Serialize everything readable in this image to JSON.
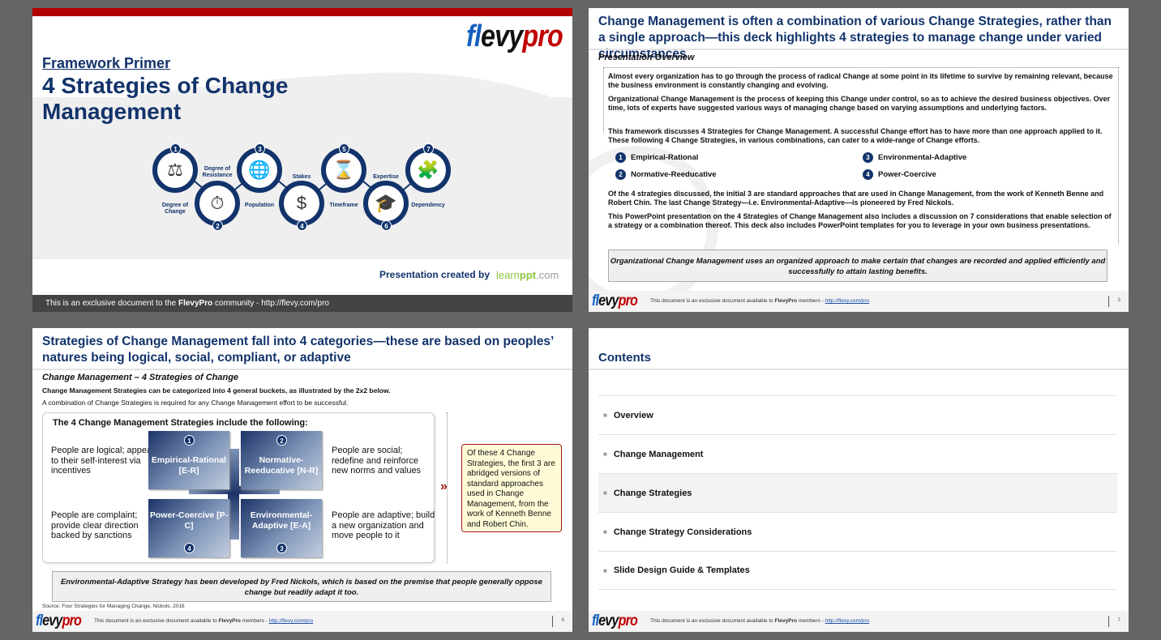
{
  "brand": {
    "logo_parts": [
      "fl",
      "evy",
      "pro"
    ],
    "accent_red": "#b10000",
    "navy": "#12336b"
  },
  "slide1": {
    "kicker": "Framework Primer",
    "title": "4 Strategies of Change Management",
    "considerations": [
      {
        "num": "1",
        "label": "Degree of Change",
        "icon": "scales-icon"
      },
      {
        "num": "2",
        "label": "Degree of Resistance",
        "icon": "stopwatch-wrench-icon"
      },
      {
        "num": "3",
        "label": "Population",
        "icon": "globe-icon"
      },
      {
        "num": "4",
        "label": "Stakes",
        "icon": "hand-money-icon"
      },
      {
        "num": "5",
        "label": "Timeframe",
        "icon": "hourglass-icon"
      },
      {
        "num": "6",
        "label": "Expertise",
        "icon": "graduation-cap-icon"
      },
      {
        "num": "7",
        "label": "Dependency",
        "icon": "puzzle-bulb-icon"
      }
    ],
    "created_by": "Presentation created by",
    "learnppt": {
      "a": "learn",
      "b": "ppt",
      "c": ".com"
    },
    "footer": {
      "pre": "This is an exclusive document to the ",
      "bold": "FlevyPro",
      "post": " community - http://flevy.com/pro"
    }
  },
  "footer": {
    "text_pre": "This document is an exclusive document available to ",
    "text_bold": "FlevyPro",
    "text_mid": " members - ",
    "link": "http://flevy.com/pro"
  },
  "slide2": {
    "title": "Change Management is often a combination of various Change Strategies, rather than a single approach—this deck highlights 4 strategies to manage change under varied circumstances",
    "subtitle": "Presentation Overview",
    "paragraphs": [
      "Almost every organization has to go through the process of radical Change at some point in its lifetime to survive by remaining relevant, because the business environment is constantly changing and evolving.",
      "Organizational Change Management is the process of keeping this Change under control, so as to achieve the desired business objectives.  Over time, lots of experts have suggested various ways of managing change based on varying assumptions and underlying factors.",
      "This framework discusses 4 Strategies for Change Management. A successful Change effort has to have more than one approach applied to it.  These following 4 Change Strategies, in various combinations, can cater to a wide-range of Change efforts.",
      "Of the 4 strategies discussed, the initial 3 are standard approaches that are used in Change Management, from the work of Kenneth Benne and Robert Chin.  The last Change Strategy—i.e. Environmental-Adaptive—is pioneered by Fred Nickols.",
      "This PowerPoint presentation on the 4 Strategies of Change Management also includes a discussion on 7 considerations that enable selection of a strategy or a combination thereof.  This deck also includes PowerPoint templates for you to leverage in your own business presentations."
    ],
    "strategies": [
      {
        "num": "1",
        "label": "Empirical-Rational"
      },
      {
        "num": "2",
        "label": "Normative-Reeducative"
      },
      {
        "num": "3",
        "label": "Environmental-Adaptive"
      },
      {
        "num": "4",
        "label": "Power-Coercive"
      }
    ],
    "callout": "Organizational Change Management uses an organized approach to make certain that changes are recorded and applied efficiently and successfully to attain lasting benefits.",
    "page": "3"
  },
  "slide3": {
    "title": "Strategies of Change Management fall into 4 categories—these are based on peoples’ natures being logical, social, compliant, or adaptive",
    "subtitle": "Change Management – 4 Strategies of Change",
    "line1": "Change Management Strategies can be categorized into 4 general buckets, as illustrated by the 2x2 below.",
    "line2": "A combination of Change Strategies is required for any Change Management effort to be successful.",
    "panel_title": "The 4 Change Management Strategies include the following:",
    "quadrants": [
      {
        "num": "1",
        "name": "Empirical-Rational [E-R]",
        "desc": "People are logical; appeal to their self-interest via incentives"
      },
      {
        "num": "2",
        "name": "Normative-Reeducative [N-R]",
        "desc": "People are social; redefine and reinforce new norms and values"
      },
      {
        "num": "4",
        "name": "Power-Coercive [P-C]",
        "desc": "People are complaint; provide clear direction backed by sanctions"
      },
      {
        "num": "3",
        "name": "Environmental-Adaptive [E-A]",
        "desc": "People are adaptive; build a new organization and move people to it"
      }
    ],
    "note": "Of these 4 Change Strategies, the first 3 are abridged versions of standard approaches used in Change Management, from the work of Kenneth Benne and Robert Chin.",
    "callout": "Environmental-Adaptive Strategy has been developed by Fred Nickols, which is based on the premise that people generally oppose change but readily adapt it too.",
    "source": "Source: Four Strategies for Managing Change, Nickols, 2016",
    "page": "6"
  },
  "slide4": {
    "title": "Contents",
    "items": [
      {
        "label": "Overview",
        "active": false
      },
      {
        "label": "Change Management",
        "active": false
      },
      {
        "label": "Change Strategies",
        "active": true
      },
      {
        "label": "Change Strategy Considerations",
        "active": false
      },
      {
        "label": "Slide Design Guide & Templates",
        "active": false
      }
    ],
    "page": "7"
  }
}
